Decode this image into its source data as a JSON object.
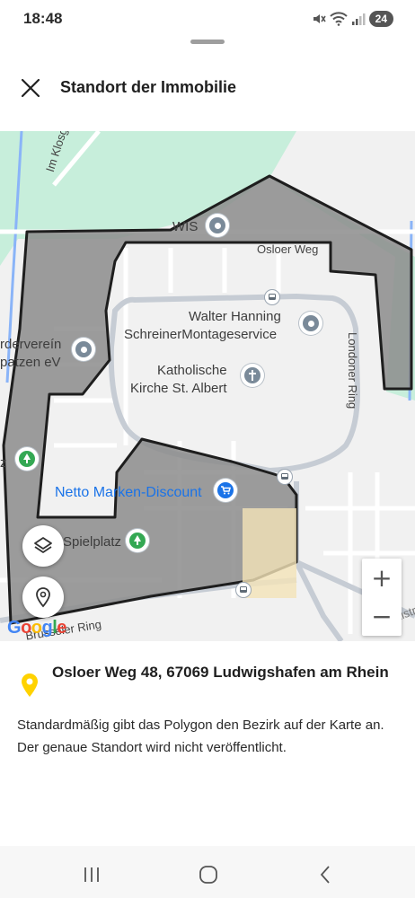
{
  "status_bar": {
    "time": "18:48",
    "battery": "24",
    "icons": [
      "mute-icon",
      "wifi-icon",
      "signal-icon",
      "battery-icon"
    ]
  },
  "header": {
    "close_icon": "close-icon",
    "title": "Standort der Immobilie"
  },
  "map": {
    "streets": {
      "im_klosgarten": "Im Klosgarten",
      "osloer_weg": "Osloer Weg",
      "londoner_ring": "Londoner Ring",
      "bruesseler_ring": "Brüsseler Ring",
      "helsinkistr": "Helsinkistraße"
    },
    "places": {
      "wis": "WIS",
      "walter_hanning_line1": "Walter Hanning",
      "walter_hanning_line2": "SchreinerMontageservice",
      "kirche_line1": "Katholische",
      "kirche_line2": "Kirche St. Albert",
      "verein_line1": "rdervereín",
      "verein_line2": "patzen eV",
      "netto": "Netto Marken-Discount",
      "spielplatz": "Spielplatz",
      "left_z": "z"
    },
    "controls": {
      "layers_icon": "layers-icon",
      "location_icon": "location-pin-icon",
      "zoom_in": "+",
      "zoom_out": "−"
    },
    "attribution": "Google",
    "colors": {
      "polygon_fill": "#8c8c8c",
      "polygon_stroke": "#1e1e1e",
      "water": "#8ab4f8",
      "park": "#c7eedb",
      "road": "#ffffff",
      "major_road": "#c6ccd4"
    }
  },
  "info": {
    "address": "Osloer Weg 48, 67069 Ludwigshafen am Rhein",
    "description": "Standardmäßig gibt das Polygon den Bezirk auf der Karte an. Der genaue Standort wird nicht veröffentlicht.",
    "pin_color": "#ffd200"
  },
  "nav_bar": {
    "recents_icon": "recents-icon",
    "home_icon": "home-icon",
    "back_icon": "back-icon"
  }
}
